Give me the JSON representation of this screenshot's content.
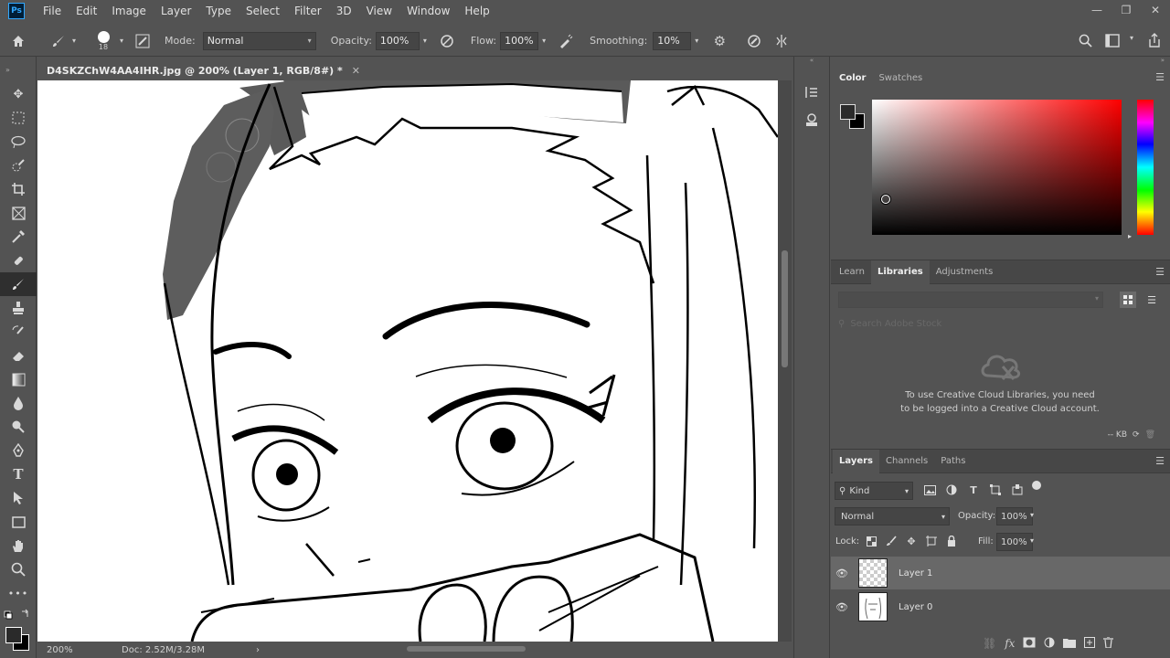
{
  "app": {
    "logo": "Ps"
  },
  "menu": [
    "File",
    "Edit",
    "Image",
    "Layer",
    "Type",
    "Select",
    "Filter",
    "3D",
    "View",
    "Window",
    "Help"
  ],
  "window_controls": {
    "minimize": "—",
    "restore": "❐",
    "close": "✕"
  },
  "options": {
    "brush_size": "18",
    "mode_label": "Mode:",
    "mode_value": "Normal",
    "opacity_label": "Opacity:",
    "opacity_value": "100%",
    "flow_label": "Flow:",
    "flow_value": "100%",
    "smoothing_label": "Smoothing:",
    "smoothing_value": "10%"
  },
  "document": {
    "tab_title": "D4SKZChW4AA4IHR.jpg @ 200% (Layer 1, RGB/8#) *",
    "close": "✕"
  },
  "status": {
    "zoom": "200%",
    "doc": "Doc: 2.52M/3.28M",
    "arrow": "›"
  },
  "color_panel": {
    "tabs": [
      "Color",
      "Swatches"
    ],
    "active": 0
  },
  "libraries_panel": {
    "tabs": [
      "Learn",
      "Libraries",
      "Adjustments"
    ],
    "active": 1,
    "search_placeholder": "Search Adobe Stock",
    "message": "To use Creative Cloud Libraries, you need to be logged into a Creative Cloud account.",
    "size_label": "-- KB"
  },
  "layers_panel": {
    "tabs": [
      "Layers",
      "Channels",
      "Paths"
    ],
    "active": 0,
    "filter_label": "Kind",
    "blend_mode": "Normal",
    "opacity_label": "Opacity:",
    "opacity_value": "100%",
    "lock_label": "Lock:",
    "fill_label": "Fill:",
    "fill_value": "100%",
    "layers": [
      {
        "name": "Layer 1",
        "selected": true
      },
      {
        "name": "Layer 0",
        "selected": false
      }
    ]
  },
  "colors": {
    "accent": "#31a8ff",
    "ui_bg": "#535353",
    "panel_dark": "#474747"
  }
}
